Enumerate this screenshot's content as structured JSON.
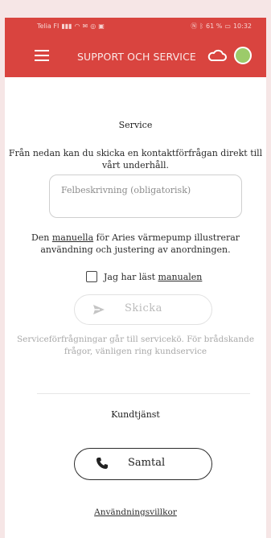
{
  "statusbar": {
    "carrier": "Telia FI",
    "signal_icons": "signal wifi",
    "battery": "61 %",
    "time": "10:32"
  },
  "appbar": {
    "title": "SUPPORT OCH SERVICE",
    "connection_status_color": "#9ccb6a"
  },
  "service": {
    "title": "Service",
    "intro": "Från nedan kan du skicka en kontaktförfrågan direkt till vårt underhåll.",
    "description_placeholder": "Felbeskrivning (obligatorisk)",
    "manual_prefix": "Den ",
    "manual_link": "manuella",
    "manual_suffix": " för Aries värmepump illustrerar användning och justering av anordningen.",
    "checkbox_prefix": "Jag har läst ",
    "checkbox_link": "manualen",
    "send_label": "Skicka",
    "note": "Serviceförfrågningar går till servicekö. För brådskande frågor, vänligen ring kundservice"
  },
  "customer_service": {
    "title": "Kundtjänst",
    "call_label": "Samtal"
  },
  "footer": {
    "terms_link": "Användningsvillkor"
  },
  "colors": {
    "brand": "#d9443f",
    "background": "#f6e6e6",
    "disabled_text": "#bbbbbb"
  }
}
